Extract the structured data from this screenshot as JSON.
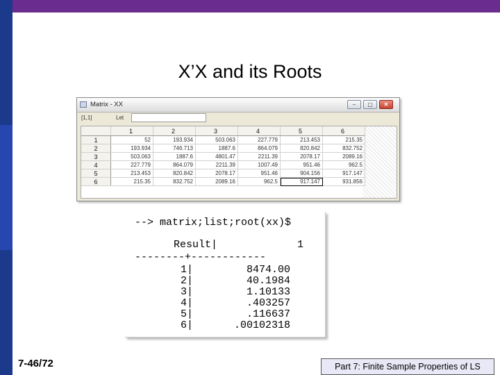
{
  "slide": {
    "title": "X’X and its Roots",
    "number": "7-46/72",
    "footer": "Part 7: Finite Sample Properties of LS"
  },
  "matrix_window": {
    "title": "Matrix - XX",
    "cell_ref": "[1,1]",
    "let_label": "Let",
    "buttons": {
      "minimize": "‒",
      "maximize": "▢",
      "close": "✕"
    },
    "column_headers": [
      "1",
      "2",
      "3",
      "4",
      "5",
      "6"
    ],
    "rows": [
      {
        "label": "1",
        "values": [
          "52",
          "193.934",
          "503.063",
          "227.779",
          "213.453",
          "215.35"
        ]
      },
      {
        "label": "2",
        "values": [
          "193.934",
          "746.713",
          "1887.6",
          "864.079",
          "820.842",
          "832.752"
        ]
      },
      {
        "label": "3",
        "values": [
          "503.063",
          "1887.6",
          "4801.47",
          "2211.39",
          "2078.17",
          "2089.16"
        ]
      },
      {
        "label": "4",
        "values": [
          "227.779",
          "864.079",
          "2211.39",
          "1007.49",
          "951.46",
          "962.5"
        ]
      },
      {
        "label": "5",
        "values": [
          "213.453",
          "820.842",
          "2078.17",
          "951.46",
          "904.156",
          "917.147"
        ]
      },
      {
        "label": "6",
        "values": [
          "215.35",
          "832.752",
          "2089.16",
          "962.5",
          "917.147",
          "931.856"
        ]
      }
    ]
  },
  "console": {
    "command": "--> matrix;list;root(xx)$",
    "result_label": "Result|",
    "result_col": "1",
    "separator": "--------+------------",
    "rows": [
      {
        "idx": "1|",
        "val": "8474.00"
      },
      {
        "idx": "2|",
        "val": "40.1984"
      },
      {
        "idx": "3|",
        "val": "1.10133"
      },
      {
        "idx": "4|",
        "val": ".403257"
      },
      {
        "idx": "5|",
        "val": ".116637"
      },
      {
        "idx": "6|",
        "val": ".00102318"
      }
    ]
  }
}
